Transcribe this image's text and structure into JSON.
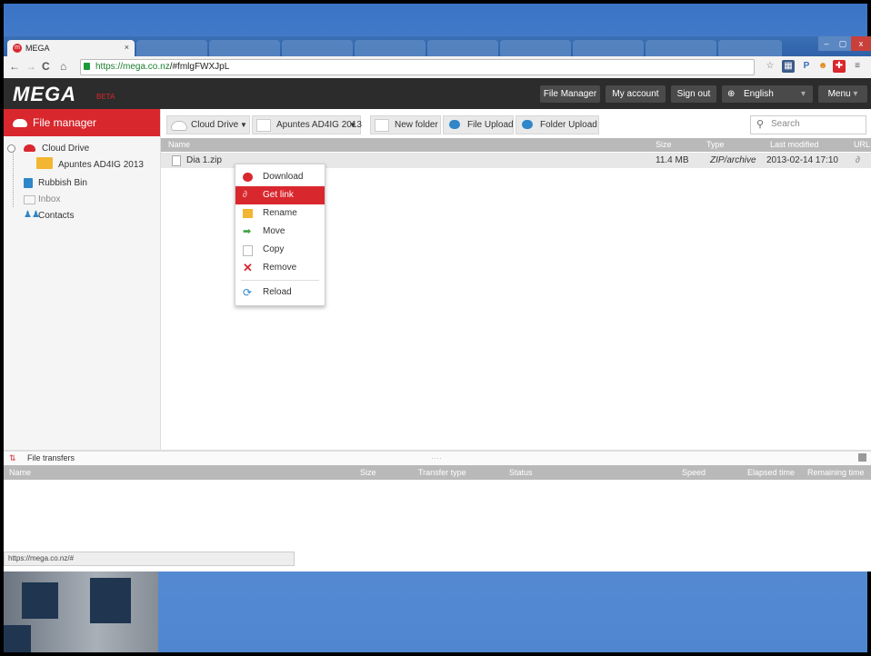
{
  "tab": {
    "title": "MEGA",
    "close": "×"
  },
  "address": {
    "host": "https://mega.co.nz",
    "path": "/#fmlgFWXJpL"
  },
  "window_controls": {
    "min": "–",
    "max": "▢",
    "close": "x"
  },
  "extension_icons": [
    "☆",
    "▦",
    "P",
    "☻",
    "✚",
    "≡"
  ],
  "header": {
    "logo": "MEGA",
    "beta": "BETA",
    "file_manager": "File Manager",
    "my_account": "My account",
    "sign_out": "Sign out",
    "language": "English",
    "menu": "Menu"
  },
  "sidebar": {
    "title": "File manager",
    "items": [
      {
        "label": "Cloud Drive",
        "icon": "cloud-icon"
      },
      {
        "label": "Apuntes AD4IG 2013",
        "icon": "folder-icon"
      },
      {
        "label": "Rubbish Bin",
        "icon": "rubbish-bin-icon"
      },
      {
        "label": "Inbox",
        "icon": "inbox-icon"
      },
      {
        "label": "Contacts",
        "icon": "contacts-icon"
      }
    ]
  },
  "toolbar": {
    "crumb1": "Cloud Drive",
    "crumb2": "Apuntes AD4IG 2013",
    "new_folder": "New folder",
    "file_upload": "File Upload",
    "folder_upload": "Folder Upload",
    "search_placeholder": "Search"
  },
  "list": {
    "headers": {
      "name": "Name",
      "size": "Size",
      "type": "Type",
      "modified": "Last modified",
      "url": "URL"
    },
    "rows": [
      {
        "name": "Dia 1.zip",
        "size": "11.4 MB",
        "type": "ZIP/archive",
        "modified": "2013-02-14 17:10"
      }
    ]
  },
  "context_menu": {
    "items": [
      "Download",
      "Get link",
      "Rename",
      "Move",
      "Copy",
      "Remove",
      "Reload"
    ],
    "highlighted": "Get link"
  },
  "transfers": {
    "title": "File transfers",
    "headers": {
      "name": "Name",
      "size": "Size",
      "type": "Transfer type",
      "status": "Status",
      "speed": "Speed",
      "elapsed": "Elapsed time",
      "remaining": "Remaining time"
    }
  },
  "statusbar": {
    "url": "https://mega.co.nz/#"
  },
  "colors": {
    "accent": "#d9272e",
    "header": "#2c2c2c"
  }
}
